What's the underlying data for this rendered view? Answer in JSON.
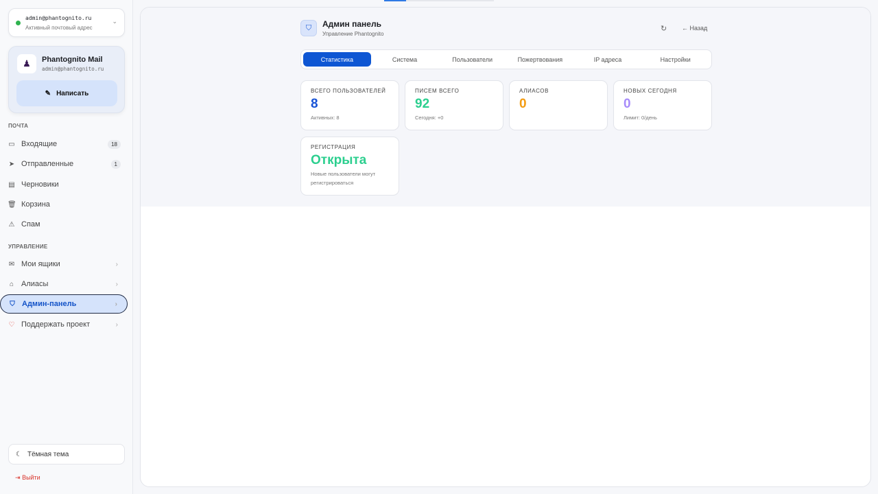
{
  "account": {
    "email": "admin@phantognito.ru",
    "status": "Активный почтовый адрес"
  },
  "brand": {
    "name": "Phantognito Mail",
    "email": "admin@phantognito.ru",
    "compose": "Написать"
  },
  "sidebar": {
    "mail_section": "ПОЧТА",
    "mail_items": [
      {
        "label": "Входящие",
        "badge": "18"
      },
      {
        "label": "Отправленные",
        "badge": "1"
      },
      {
        "label": "Черновики"
      },
      {
        "label": "Корзина"
      },
      {
        "label": "Спам"
      }
    ],
    "manage_section": "УПРАВЛЕНИЕ",
    "manage_items": [
      {
        "label": "Мои ящики"
      },
      {
        "label": "Алиасы"
      },
      {
        "label": "Админ-панель"
      },
      {
        "label": "Поддержать проект"
      }
    ],
    "theme": "Тёмная тема",
    "logout": "Выйти"
  },
  "header": {
    "title": "Админ панель",
    "subtitle": "Управление Phantognito",
    "back": "← Назад"
  },
  "tabs": [
    "Статистика",
    "Система",
    "Пользователи",
    "Пожертвования",
    "IP адреса",
    "Настройки"
  ],
  "active_tab": "Статистика",
  "cards": [
    {
      "label": "ВСЕГО ПОЛЬЗОВАТЕЛЕЙ",
      "value": "8",
      "sub": "Активных: 8",
      "color": "#1652d6"
    },
    {
      "label": "ПИСЕМ ВСЕГО",
      "value": "92",
      "sub": "Сегодня: +0",
      "color": "#2ccf8f"
    },
    {
      "label": "АЛИАСОВ",
      "value": "0",
      "sub": "",
      "color": "#f39c12"
    },
    {
      "label": "НОВЫХ СЕГОДНЯ",
      "value": "0",
      "sub": "Лимит: 0/день",
      "color": "#a78bfa"
    },
    {
      "label": "РЕГИСТРАЦИЯ",
      "value": "Открыта",
      "sub": "Новые пользователи могут регистрироваться",
      "color": "#2ccf8f"
    }
  ]
}
